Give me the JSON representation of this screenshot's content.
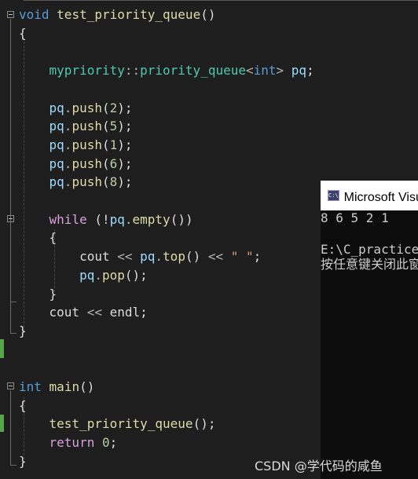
{
  "editor": {
    "lines": [
      [
        [
          "kw",
          "void"
        ],
        [
          "txt",
          " "
        ],
        [
          "fn",
          "test_priority_queue"
        ],
        [
          "txt",
          "()"
        ]
      ],
      [
        [
          "txt",
          "{"
        ]
      ],
      [],
      [
        [
          "txt",
          "    "
        ],
        [
          "ty",
          "mypriority"
        ],
        [
          "op",
          "::"
        ],
        [
          "ty",
          "priority_queue"
        ],
        [
          "op",
          "<"
        ],
        [
          "kw",
          "int"
        ],
        [
          "op",
          "> "
        ],
        [
          "var",
          "pq"
        ],
        [
          "txt",
          ";"
        ]
      ],
      [],
      [
        [
          "txt",
          "    "
        ],
        [
          "var",
          "pq"
        ],
        [
          "op",
          "."
        ],
        [
          "fn",
          "push"
        ],
        [
          "txt",
          "("
        ],
        [
          "num",
          "2"
        ],
        [
          "txt",
          ");"
        ]
      ],
      [
        [
          "txt",
          "    "
        ],
        [
          "var",
          "pq"
        ],
        [
          "op",
          "."
        ],
        [
          "fn",
          "push"
        ],
        [
          "txt",
          "("
        ],
        [
          "num",
          "5"
        ],
        [
          "txt",
          ");"
        ]
      ],
      [
        [
          "txt",
          "    "
        ],
        [
          "var",
          "pq"
        ],
        [
          "op",
          "."
        ],
        [
          "fn",
          "push"
        ],
        [
          "txt",
          "("
        ],
        [
          "num",
          "1"
        ],
        [
          "txt",
          ");"
        ]
      ],
      [
        [
          "txt",
          "    "
        ],
        [
          "var",
          "pq"
        ],
        [
          "op",
          "."
        ],
        [
          "fn",
          "push"
        ],
        [
          "txt",
          "("
        ],
        [
          "num",
          "6"
        ],
        [
          "txt",
          ");"
        ]
      ],
      [
        [
          "txt",
          "    "
        ],
        [
          "var",
          "pq"
        ],
        [
          "op",
          "."
        ],
        [
          "fn",
          "push"
        ],
        [
          "txt",
          "("
        ],
        [
          "num",
          "8"
        ],
        [
          "txt",
          ");"
        ]
      ],
      [],
      [
        [
          "txt",
          "    "
        ],
        [
          "ctl",
          "while"
        ],
        [
          "txt",
          " (!"
        ],
        [
          "var",
          "pq"
        ],
        [
          "op",
          "."
        ],
        [
          "fn",
          "empty"
        ],
        [
          "txt",
          "())"
        ]
      ],
      [
        [
          "txt",
          "    {"
        ]
      ],
      [
        [
          "txt",
          "        cout "
        ],
        [
          "op",
          "<<"
        ],
        [
          "txt",
          " "
        ],
        [
          "var",
          "pq"
        ],
        [
          "op",
          "."
        ],
        [
          "fn",
          "top"
        ],
        [
          "txt",
          "() "
        ],
        [
          "op",
          "<<"
        ],
        [
          "txt",
          " "
        ],
        [
          "str",
          "\" \""
        ],
        [
          "txt",
          ";"
        ]
      ],
      [
        [
          "txt",
          "        "
        ],
        [
          "var",
          "pq"
        ],
        [
          "op",
          "."
        ],
        [
          "fn",
          "pop"
        ],
        [
          "txt",
          "();"
        ]
      ],
      [
        [
          "txt",
          "    }"
        ]
      ],
      [
        [
          "txt",
          "    cout "
        ],
        [
          "op",
          "<<"
        ],
        [
          "txt",
          " endl;"
        ]
      ],
      [
        [
          "txt",
          "}"
        ]
      ],
      [],
      [],
      [
        [
          "kw",
          "int"
        ],
        [
          "txt",
          " "
        ],
        [
          "fn",
          "main"
        ],
        [
          "txt",
          "()"
        ]
      ],
      [
        [
          "txt",
          "{"
        ]
      ],
      [
        [
          "txt",
          "    "
        ],
        [
          "fn",
          "test_priority_queue"
        ],
        [
          "txt",
          "();"
        ]
      ],
      [
        [
          "txt",
          "    "
        ],
        [
          "ctl",
          "return"
        ],
        [
          "txt",
          " "
        ],
        [
          "num",
          "0"
        ],
        [
          "txt",
          ";"
        ]
      ],
      [
        [
          "txt",
          "}"
        ]
      ]
    ]
  },
  "console": {
    "title": "Microsoft Visual Studio 调试控制台",
    "output_line": "8 6 5 2 1",
    "path_line": "E:\\C_practice",
    "prompt_line": "按任意键关闭此窗口..."
  },
  "watermark": "CSDN @学代码的咸鱼"
}
